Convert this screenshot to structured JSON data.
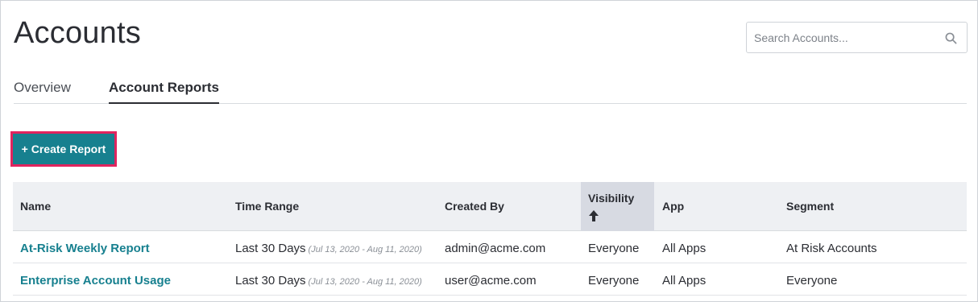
{
  "header": {
    "title": "Accounts"
  },
  "search": {
    "placeholder": "Search Accounts..."
  },
  "tabs": [
    {
      "label": "Overview",
      "active": false
    },
    {
      "label": "Account Reports",
      "active": true
    }
  ],
  "toolbar": {
    "create_label": "+ Create Report"
  },
  "table": {
    "columns": [
      "Name",
      "Time Range",
      "Created By",
      "Visibility",
      "App",
      "Segment"
    ],
    "sorted_column": "Visibility",
    "rows": [
      {
        "name": "At-Risk Weekly Report",
        "time_range": "Last 30 Days",
        "date_range": "(Jul 13, 2020 - Aug 11, 2020)",
        "created_by": "admin@acme.com",
        "visibility": "Everyone",
        "app": "All Apps",
        "segment": "At Risk Accounts"
      },
      {
        "name": "Enterprise Account Usage",
        "time_range": "Last 30 Days",
        "date_range": "(Jul 13, 2020 - Aug 11, 2020)",
        "created_by": "user@acme.com",
        "visibility": "Everyone",
        "app": "All Apps",
        "segment": "Everyone"
      }
    ]
  },
  "colors": {
    "accent": "#17808f",
    "highlight_border": "#e0245e",
    "header_bg": "#eef0f3",
    "sorted_header_bg": "#d7dae2"
  },
  "icons": {
    "search": "search-icon",
    "sort": "arrow-up-icon"
  }
}
